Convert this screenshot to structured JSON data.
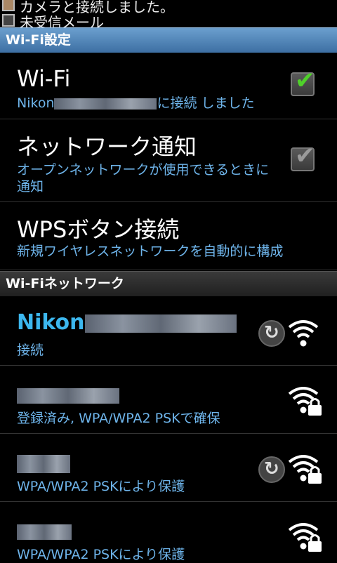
{
  "notification_bar": {
    "line1": "カメラと接続しました。",
    "line2": "未受信メール"
  },
  "section_wifi_settings": {
    "title": "Wi-Fi設定"
  },
  "wifi_toggle": {
    "title": "Wi-Fi",
    "subtitle_prefix": "Nikon",
    "subtitle_suffix": "に接続 しました",
    "checked": true
  },
  "network_notification": {
    "title": "ネットワーク通知",
    "subtitle": "オープンネットワークが使用できるときに通知",
    "checked": true
  },
  "wps_button": {
    "title": "WPSボタン接続",
    "subtitle": "新規ワイヤレスネットワークを自動的に構成"
  },
  "section_wifi_networks": {
    "title": "Wi-Fiネットワーク"
  },
  "networks": [
    {
      "name": "Nikon",
      "status": "接続",
      "wps": true,
      "locked": false
    },
    {
      "name": "",
      "status": "登録済み, WPA/WPA2 PSKで確保",
      "wps": false,
      "locked": true
    },
    {
      "name": "",
      "status": "WPA/WPA2 PSKにより保護",
      "wps": true,
      "locked": true
    },
    {
      "name": "",
      "status": "WPA/WPA2 PSKにより保護",
      "wps": false,
      "locked": true
    }
  ],
  "colors": {
    "accent_blue": "#6eb4ea",
    "network_name": "#3cb7ee",
    "check_green": "#4fd02a",
    "check_gray": "#9a9a9a"
  }
}
